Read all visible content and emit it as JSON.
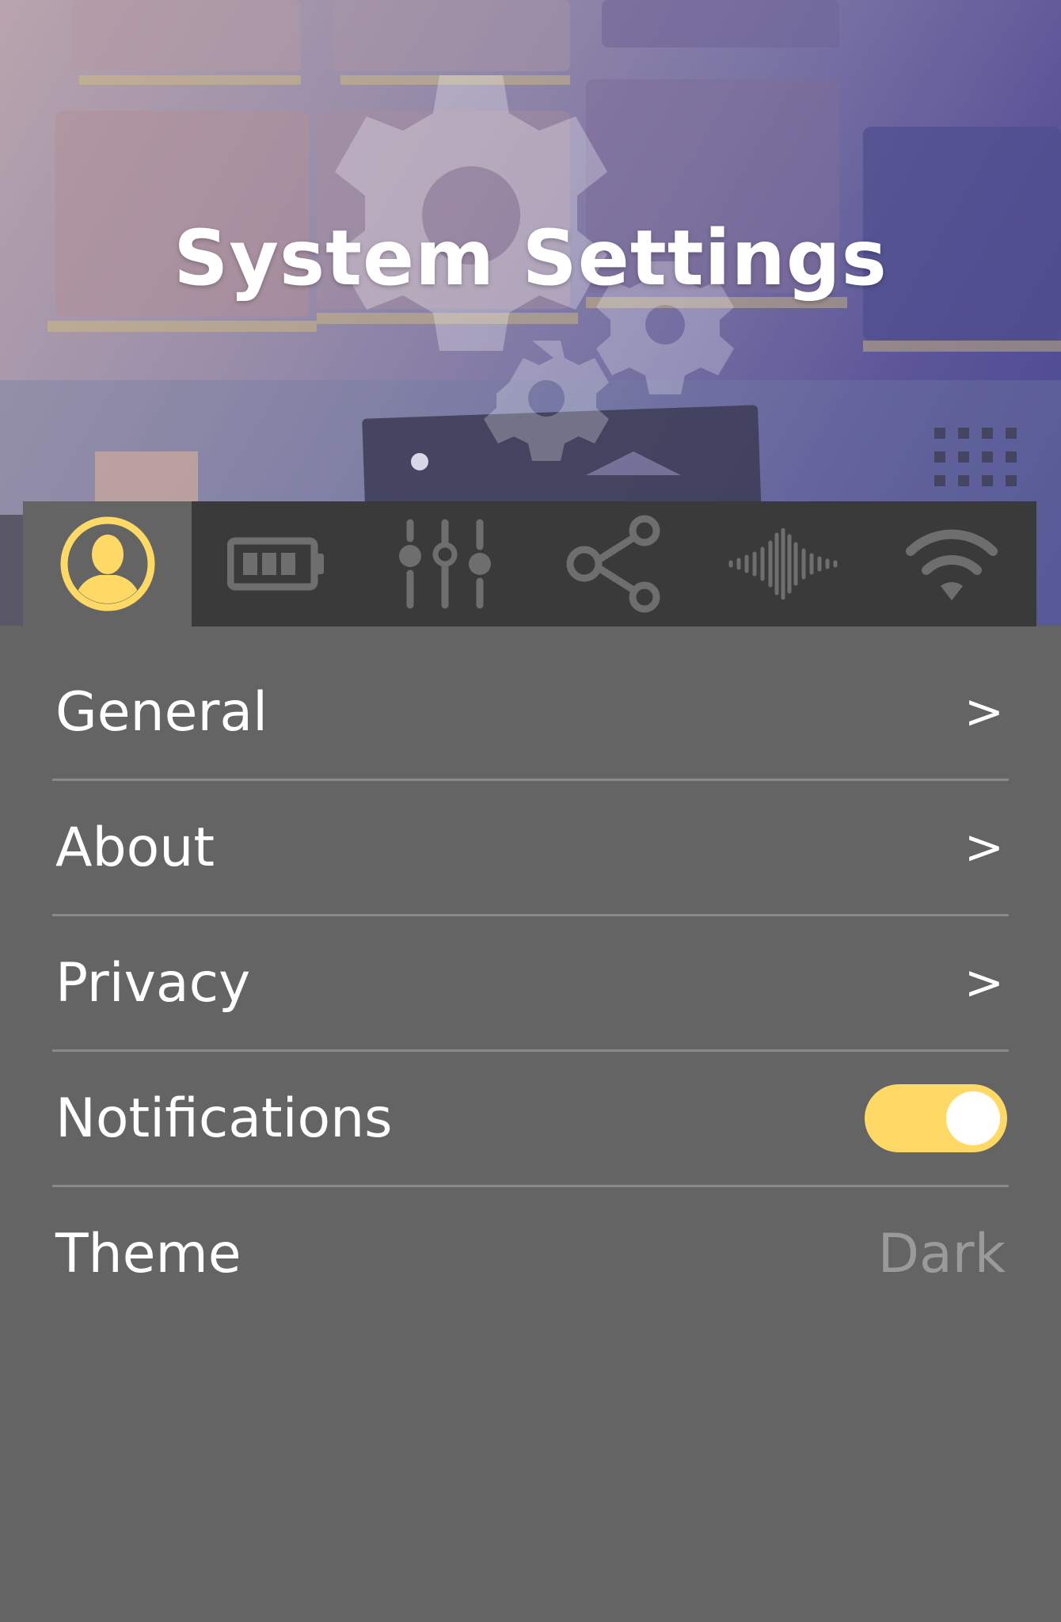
{
  "header": {
    "title": "System Settings"
  },
  "tabs": [
    {
      "icon": "user-icon",
      "active": true
    },
    {
      "icon": "battery-icon",
      "active": false
    },
    {
      "icon": "sliders-icon",
      "active": false
    },
    {
      "icon": "share-icon",
      "active": false
    },
    {
      "icon": "sound-wave-icon",
      "active": false
    },
    {
      "icon": "wifi-icon",
      "active": false
    }
  ],
  "settings": {
    "general": {
      "label": "General",
      "chevron": ">"
    },
    "about": {
      "label": "About",
      "chevron": ">"
    },
    "privacy": {
      "label": "Privacy",
      "chevron": ">"
    },
    "notifications": {
      "label": "Notifications",
      "enabled": true
    },
    "theme": {
      "label": "Theme",
      "value": "Dark"
    }
  },
  "colors": {
    "accent": "#ffd966",
    "background": "#646464",
    "tabbar": "#3a3a3a",
    "icon_inactive": "#6e6e6e",
    "text": "#ffffff",
    "muted_text": "#9a9a9a"
  }
}
